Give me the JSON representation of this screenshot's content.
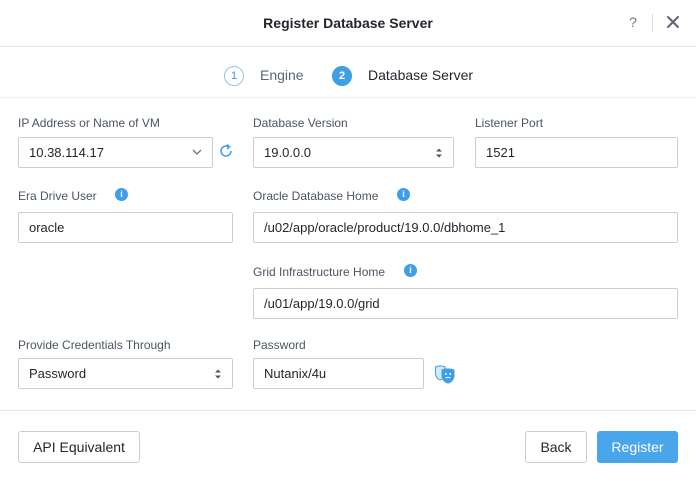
{
  "dialog": {
    "title": "Register Database Server",
    "help_label": "?",
    "close_icon": "close-icon"
  },
  "steps": [
    {
      "number": "1",
      "label": "Engine",
      "state": "completed"
    },
    {
      "number": "2",
      "label": "Database Server",
      "state": "active"
    }
  ],
  "form": {
    "ip": {
      "label": "IP Address or Name of VM",
      "value": "10.38.114.17"
    },
    "db_version": {
      "label": "Database Version",
      "value": "19.0.0.0"
    },
    "listener_port": {
      "label": "Listener Port",
      "value": "1521"
    },
    "era_drive_user": {
      "label": "Era Drive User",
      "value": "oracle",
      "info": "i"
    },
    "oracle_home": {
      "label": "Oracle Database Home",
      "value": "/u02/app/oracle/product/19.0.0/dbhome_1",
      "info": "i"
    },
    "grid_home": {
      "label": "Grid Infrastructure Home",
      "value": "/u01/app/19.0.0/grid",
      "info": "i"
    },
    "credentials": {
      "label": "Provide Credentials Through",
      "value": "Password"
    },
    "password": {
      "label": "Password",
      "value": "Nutanix/4u"
    }
  },
  "footer": {
    "api_label": "API Equivalent",
    "back_label": "Back",
    "register_label": "Register"
  },
  "colors": {
    "accent": "#3e9ee6",
    "primary_button": "#4aa6ea",
    "border": "#c9ced4"
  }
}
